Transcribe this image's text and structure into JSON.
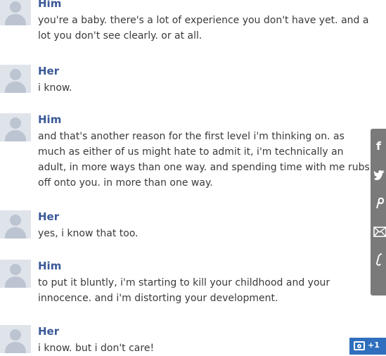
{
  "messages": [
    {
      "sender": "Him",
      "text": "you're a baby. there's a lot of experience you don't have yet. and a lot you don't see clearly. or at all."
    },
    {
      "sender": "Her",
      "text": "i know."
    },
    {
      "sender": "Him",
      "text": "and that's another reason for the first level i'm thinking on. as much as either of us might hate to admit it, i'm technically an adult, in more ways than one way. and spending time with me rubs off onto you. in more than one way."
    },
    {
      "sender": "Her",
      "text": "yes, i know that too."
    },
    {
      "sender": "Him",
      "text": "to put it bluntly, i'm starting to kill your childhood and your innocence. and i'm distorting your development."
    },
    {
      "sender": "Her",
      "text": "i know. but i don't care!"
    }
  ],
  "share_bar": {
    "icons": [
      "facebook-icon",
      "twitter-icon",
      "pinterest-icon",
      "email-icon",
      "link-icon"
    ]
  },
  "photo_badge": {
    "icon": "camera-icon",
    "count": "+1"
  },
  "colors": {
    "name": "#3b5998",
    "text": "#3a3a3a",
    "share_bar": "#7a7a7a",
    "badge": "#2f6fbd"
  }
}
